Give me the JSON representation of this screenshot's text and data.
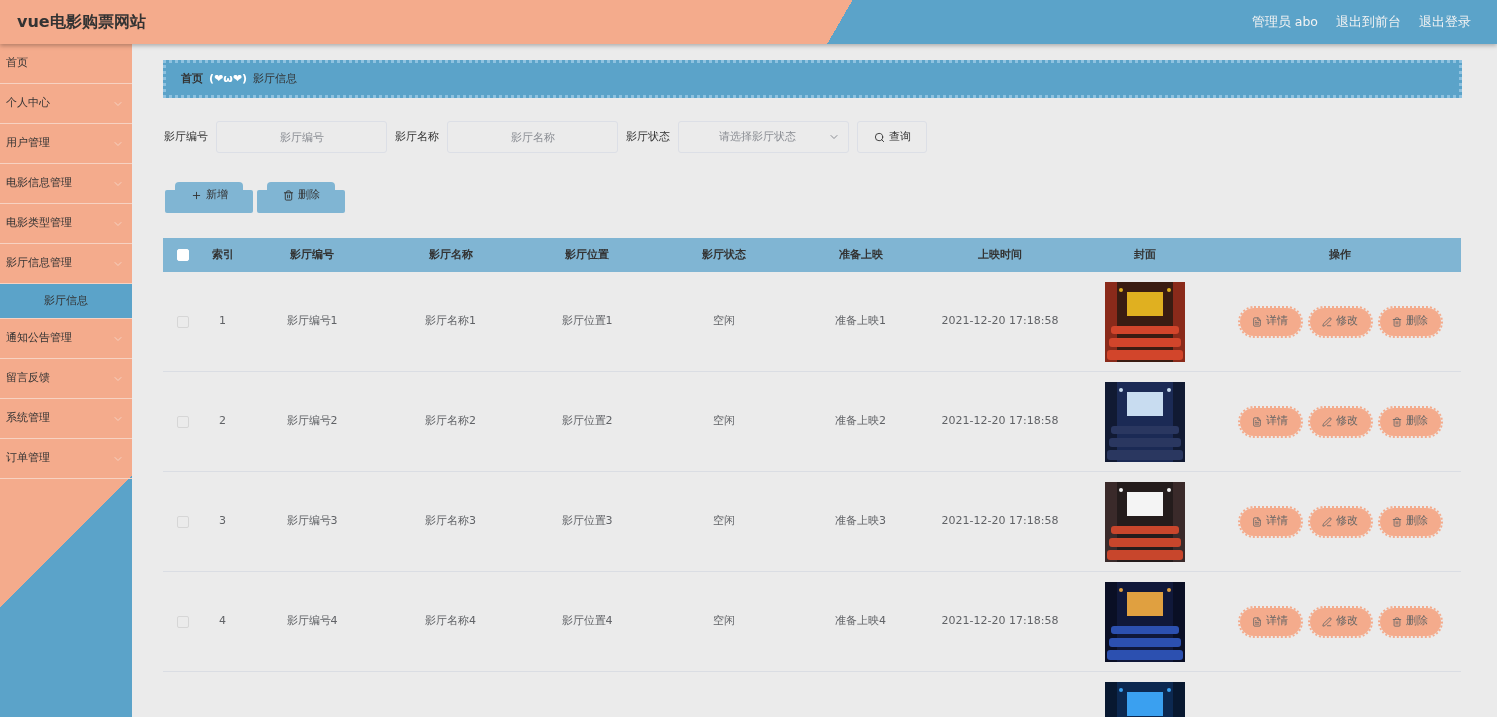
{
  "header": {
    "title": "vue电影购票网站",
    "links": [
      "管理员 abo",
      "退出到前台",
      "退出登录"
    ]
  },
  "sidebar": {
    "items": [
      {
        "label": "首页",
        "expandable": false
      },
      {
        "label": "个人中心",
        "expandable": true
      },
      {
        "label": "用户管理",
        "expandable": true
      },
      {
        "label": "电影信息管理",
        "expandable": true
      },
      {
        "label": "电影类型管理",
        "expandable": true
      },
      {
        "label": "影厅信息管理",
        "expandable": true,
        "children": [
          {
            "label": "影厅信息",
            "selected": true
          }
        ]
      },
      {
        "label": "通知公告管理",
        "expandable": true
      },
      {
        "label": "留言反馈",
        "expandable": true
      },
      {
        "label": "系统管理",
        "expandable": true
      },
      {
        "label": "订单管理",
        "expandable": true
      }
    ]
  },
  "breadcrumb": {
    "home": "首页",
    "separator": "(❤ω❤)",
    "current": "影厅信息"
  },
  "filters": [
    {
      "kind": "input",
      "label": "影厅编号",
      "placeholder": "影厅编号"
    },
    {
      "kind": "input",
      "label": "影厅名称",
      "placeholder": "影厅名称"
    },
    {
      "kind": "select",
      "label": "影厅状态",
      "placeholder": "请选择影厅状态"
    }
  ],
  "search_button": "查询",
  "actions": [
    {
      "kind": "add",
      "label": "新增"
    },
    {
      "kind": "delete",
      "label": "删除"
    }
  ],
  "table": {
    "columns": [
      "索引",
      "影厅编号",
      "影厅名称",
      "影厅位置",
      "影厅状态",
      "准备上映",
      "上映时间",
      "封面",
      "操作"
    ],
    "header_checked": false,
    "rows": [
      {
        "checked": false,
        "cells": [
          "1",
          "影厅编号1",
          "影厅名称1",
          "影厅位置1",
          "空闲",
          "准备上映1",
          "2021-12-20 17:18:58"
        ],
        "cover": {
          "kind": "picture"
        },
        "actions": [
          {
            "kind": "detail",
            "label": "详情"
          },
          {
            "kind": "edit",
            "label": "修改"
          },
          {
            "kind": "delete",
            "label": "删除"
          }
        ]
      },
      {
        "checked": false,
        "cells": [
          "2",
          "影厅编号2",
          "影厅名称2",
          "影厅位置2",
          "空闲",
          "准备上映2",
          "2021-12-20 17:18:58"
        ],
        "cover": {
          "kind": "picture"
        },
        "actions": [
          {
            "kind": "detail",
            "label": "详情"
          },
          {
            "kind": "edit",
            "label": "修改"
          },
          {
            "kind": "delete",
            "label": "删除"
          }
        ]
      },
      {
        "checked": false,
        "cells": [
          "3",
          "影厅编号3",
          "影厅名称3",
          "影厅位置3",
          "空闲",
          "准备上映3",
          "2021-12-20 17:18:58"
        ],
        "cover": {
          "kind": "picture"
        },
        "actions": [
          {
            "kind": "detail",
            "label": "详情"
          },
          {
            "kind": "edit",
            "label": "修改"
          },
          {
            "kind": "delete",
            "label": "删除"
          }
        ]
      },
      {
        "checked": false,
        "cells": [
          "4",
          "影厅编号4",
          "影厅名称4",
          "影厅位置4",
          "空闲",
          "准备上映4",
          "2021-12-20 17:18:58"
        ],
        "cover": {
          "kind": "picture"
        },
        "actions": [
          {
            "kind": "detail",
            "label": "详情"
          },
          {
            "kind": "edit",
            "label": "修改"
          },
          {
            "kind": "delete",
            "label": "删除"
          }
        ]
      },
      {
        "cover": {
          "kind": "picture"
        }
      }
    ]
  }
}
